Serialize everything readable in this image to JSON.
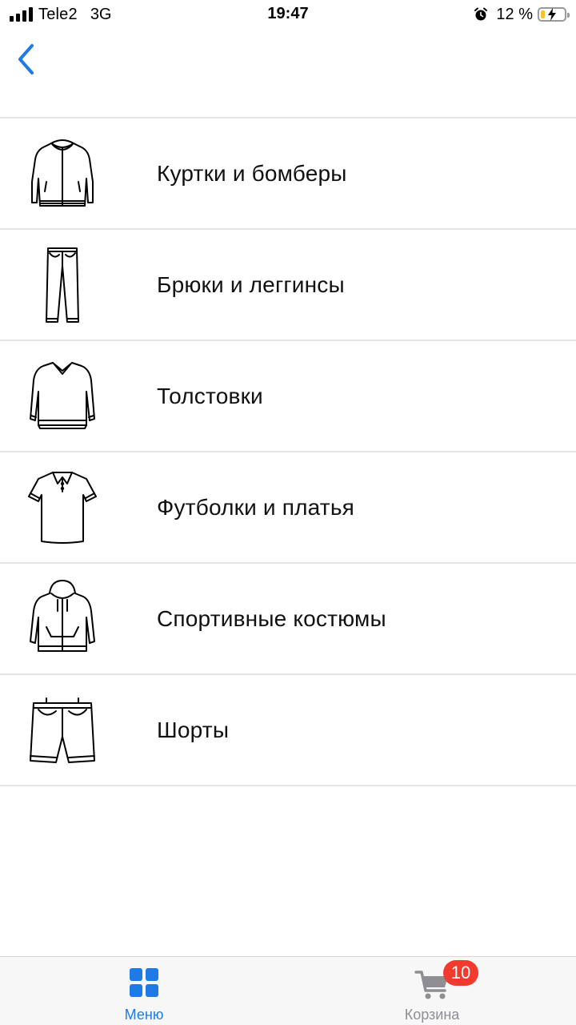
{
  "status_bar": {
    "carrier": "Tele2",
    "network": "3G",
    "time": "19:47",
    "battery_percent": "12 %",
    "battery_level": 0.12
  },
  "nav": {
    "back_icon": "chevron-left-icon",
    "accent_color": "#1e7be5"
  },
  "categories": [
    {
      "label": "Куртки и бомберы",
      "icon": "jacket-icon"
    },
    {
      "label": "Брюки и леггинсы",
      "icon": "pants-icon"
    },
    {
      "label": "Толстовки",
      "icon": "sweatshirt-icon"
    },
    {
      "label": "Футболки и платья",
      "icon": "polo-shirt-icon"
    },
    {
      "label": "Спортивные костюмы",
      "icon": "hoodie-icon"
    },
    {
      "label": "Шорты",
      "icon": "shorts-icon"
    }
  ],
  "tab_bar": {
    "menu": {
      "label": "Меню",
      "icon": "grid-icon",
      "active": true
    },
    "cart": {
      "label": "Корзина",
      "icon": "cart-icon",
      "badge": "10"
    }
  },
  "colors": {
    "accent": "#1e7be5",
    "badge": "#f23a2f",
    "inactive_tab": "#8e8e93"
  }
}
